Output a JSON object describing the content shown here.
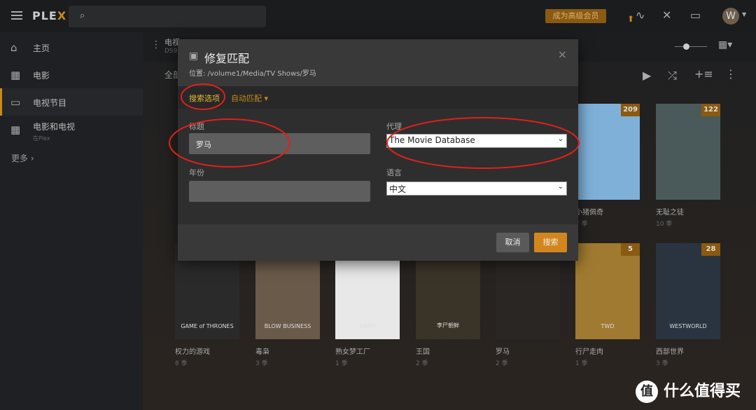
{
  "topbar": {
    "logo_main": "PLE",
    "logo_accent": "X",
    "premium_label": "成为高级会员",
    "avatar_letter": "W"
  },
  "sidebar": {
    "items": [
      {
        "label": "主页",
        "icon": "home-icon"
      },
      {
        "label": "电影",
        "icon": "film-icon"
      },
      {
        "label": "电视节目",
        "icon": "tv-icon",
        "active": true
      },
      {
        "label": "电影和电视",
        "sub": "在Plex",
        "icon": "film-icon"
      }
    ],
    "more": "更多 ›"
  },
  "library": {
    "title_partial": "电视",
    "server_partial": "DS9",
    "filter_partial": "全部",
    "row1": [
      {
        "title": "小猪佩奇",
        "seasons": "7 季",
        "badge": "209",
        "color": "#7fb0d8"
      },
      {
        "title": "无耻之徒",
        "seasons": "10 季",
        "badge": "122",
        "color": "#4a5a5a"
      }
    ],
    "row2": [
      {
        "title": "权力的游戏",
        "seasons": "8 季",
        "color": "#2a2a2a",
        "art": "GAME of THRONES"
      },
      {
        "title": "毒枭",
        "seasons": "3 季",
        "color": "#6a5a4a",
        "art": "BLOW BUSINESS"
      },
      {
        "title": "熟女梦工厂",
        "seasons": "1 季",
        "color": "#e8e8e8",
        "art": "HARD"
      },
      {
        "title": "王国",
        "seasons": "2 季",
        "color": "#3a3428",
        "art": "李尸朝鲜"
      },
      {
        "title": "罗马",
        "seasons": "2 季",
        "color": "#2a2624",
        "art": ""
      },
      {
        "title": "行尸走肉",
        "seasons": "1 季",
        "color": "#a07a30",
        "art": "TWD",
        "badge": "5"
      },
      {
        "title": "西部世界",
        "seasons": "3 季",
        "color": "#2a3440",
        "art": "WESTWORLD",
        "badge": "28"
      }
    ]
  },
  "modal": {
    "title": "修复匹配",
    "path": "位置: /volume1/Media/TV Shows/罗马",
    "tab_search": "搜索选项",
    "tab_auto": "自动匹配 ▾",
    "title_label": "标题",
    "title_value": "罗马",
    "year_label": "年份",
    "year_value": "",
    "agent_label": "代理",
    "agent_value": "The Movie Database",
    "language_label": "语言",
    "language_value": "中文",
    "cancel": "取消",
    "search": "搜索",
    "close": "×"
  },
  "colors": {
    "accent": "#c78b1a",
    "annotation": "#e0201a"
  },
  "watermark": {
    "icon": "值",
    "text": "什么值得买"
  }
}
